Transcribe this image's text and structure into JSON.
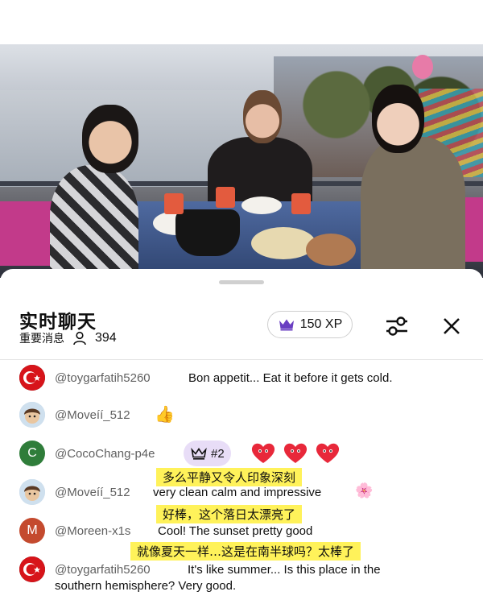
{
  "chat": {
    "title": "实时聊天",
    "mode": "重要消息",
    "viewer_count": "394",
    "xp_label": "150 XP"
  },
  "messages": [
    {
      "user": "@toygarfatih5260",
      "text": "Bon appetit... Eat it before it gets cold."
    },
    {
      "user": "@Moveíí_512",
      "emoji": "👍"
    },
    {
      "user": "@CocoChang-p4e",
      "avatar_letter": "C",
      "badge": "#2",
      "highlight": "多么平静又令人印象深刻"
    },
    {
      "user": "@Moveíí_512",
      "text": "very clean calm and impressive",
      "emoji": "🌸",
      "highlight": "好棒，这个落日太漂亮了"
    },
    {
      "user": "@Moreen-x1s",
      "avatar_letter": "M",
      "text": "Cool! The sunset pretty good",
      "highlight": "就像夏天一样…这是在南半球吗？太棒了"
    },
    {
      "user": "@toygarfatih5260",
      "text_line1": "It's like summer... Is this place in the",
      "text_line2": "southern hemisphere? Very good."
    }
  ],
  "colors": {
    "highlight": "#fff25a",
    "badge_bg": "#e8ddf7",
    "crown": "#6a3fc2",
    "heart": "#e8283a"
  }
}
